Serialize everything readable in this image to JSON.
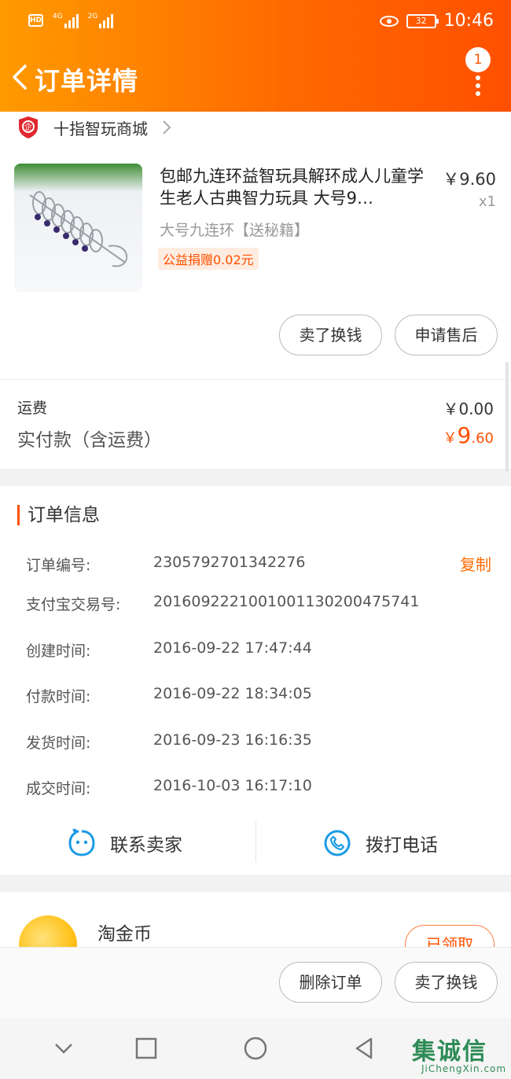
{
  "status_bar": {
    "hd": "HD",
    "net1": "4G",
    "net2": "2G",
    "battery": "32",
    "time": "10:46"
  },
  "nav": {
    "title": "订单详情",
    "badge": "1",
    "back_icon": "chevron-left-icon",
    "more_icon": "more-vertical-icon"
  },
  "store": {
    "name": "十指智玩商城",
    "icon": "enterprise-shield-icon"
  },
  "product": {
    "title": "包邮九连环益智玩具解环成人儿童学生老人古典智力玩具 大号9…",
    "sku": "大号九连环【送秘籍】",
    "tag": "公益捐赠0.02元",
    "price": "￥9.60",
    "qty": "x1"
  },
  "product_actions": {
    "sell": "卖了换钱",
    "after_sale": "申请售后"
  },
  "fees": {
    "shipping_label": "运费",
    "shipping_value": "￥0.00",
    "paid_label": "实付款（含运费）",
    "paid_currency": "￥",
    "paid_int": "9",
    "paid_dec": ".60"
  },
  "order_info": {
    "title": "订单信息",
    "copy": "复制",
    "rows": [
      {
        "label": "订单编号:",
        "value": "2305792701342276"
      },
      {
        "label": "支付宝交易号:",
        "value": "2016092221001001130200475741"
      },
      {
        "label": "创建时间:",
        "value": "2016-09-22 17:47:44"
      },
      {
        "label": "付款时间:",
        "value": "2016-09-22 18:34:05"
      },
      {
        "label": "发货时间:",
        "value": "2016-09-23 16:16:35"
      },
      {
        "label": "成交时间:",
        "value": "2016-10-03 16:17:10"
      }
    ]
  },
  "contact": {
    "seller": "联系卖家",
    "call": "拨打电话"
  },
  "coins": {
    "title": "淘金币",
    "claimed": "已领取"
  },
  "bottom_actions": {
    "delete": "删除订单",
    "sell": "卖了换钱"
  },
  "watermark": {
    "text": "集诚信",
    "sub": "JiChengXin.com"
  },
  "colors": {
    "brand": "#ff5000",
    "header_start": "#ff9a00",
    "accent_blue": "#1a9be6"
  }
}
